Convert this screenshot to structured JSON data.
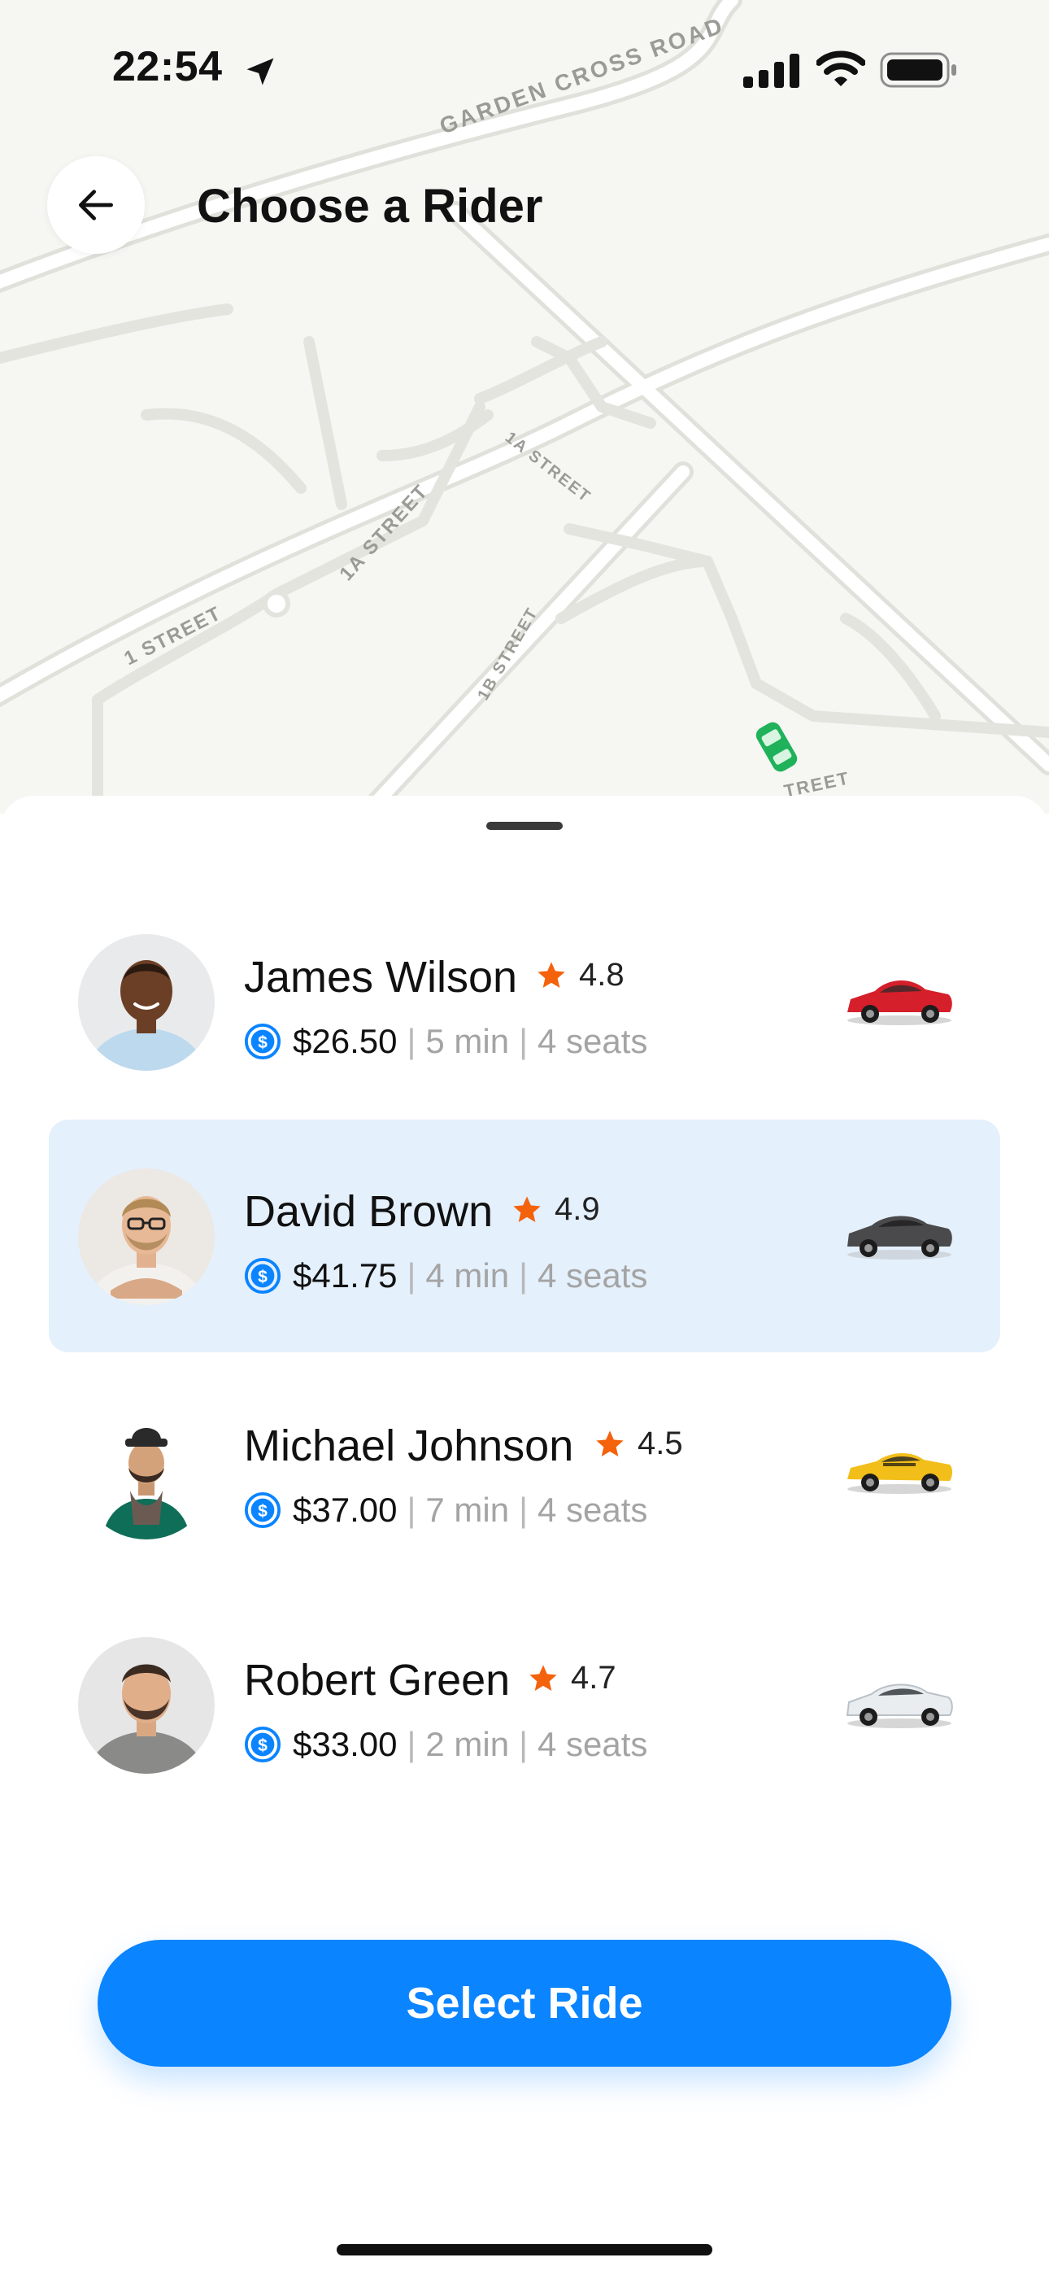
{
  "status": {
    "time": "22:54"
  },
  "header": {
    "title": "Choose a Rider"
  },
  "map": {
    "streets": [
      "GARDEN CROSS ROAD",
      "1A STREET",
      "1A STREET",
      "1 STREET",
      "1B STREET",
      "TREET"
    ]
  },
  "riders": [
    {
      "name": "James Wilson",
      "rating": "4.8",
      "price": "$26.50",
      "time": "5 min",
      "seats": "4 seats",
      "car_color": "#d51f2b",
      "selected": false
    },
    {
      "name": "David Brown",
      "rating": "4.9",
      "price": "$41.75",
      "time": "4 min",
      "seats": "4 seats",
      "car_color": "#4a4a4c",
      "selected": true
    },
    {
      "name": "Michael Johnson",
      "rating": "4.5",
      "price": "$37.00",
      "time": "7 min",
      "seats": "4 seats",
      "car_color": "#f2be1a",
      "selected": false
    },
    {
      "name": "Robert Green",
      "rating": "4.7",
      "price": "$33.00",
      "time": "2 min",
      "seats": "4 seats",
      "car_color": "#e9edf0",
      "selected": false
    }
  ],
  "actions": {
    "select_label": "Select Ride"
  },
  "colors": {
    "accent": "#0a84ff",
    "selected_row": "#e4f0fc",
    "star": "#f4620c",
    "map_bg": "#f6f6f3"
  }
}
